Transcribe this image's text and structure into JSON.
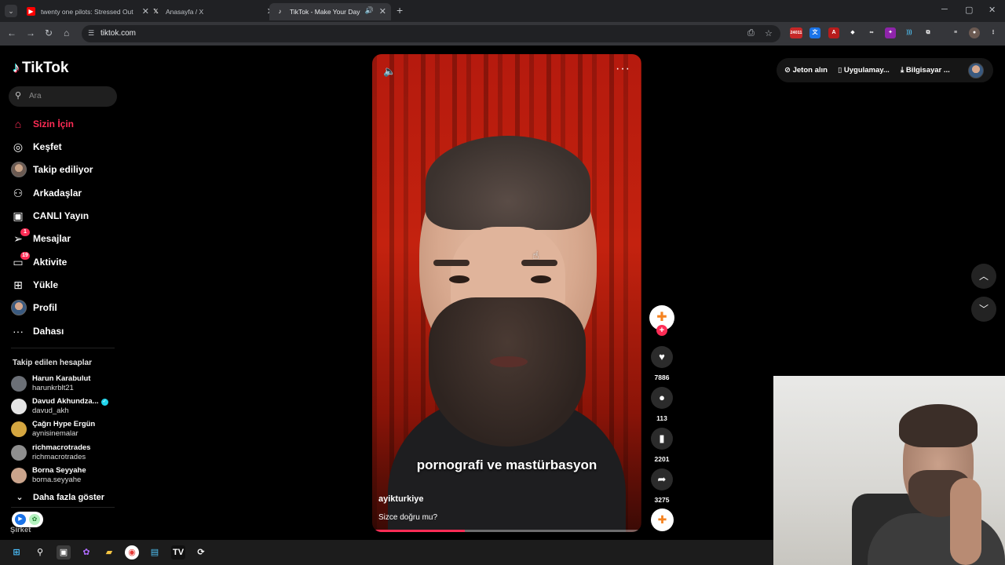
{
  "browser": {
    "tabs": [
      {
        "title": "twenty one pilots: Stressed Out",
        "favicon": "youtube-icon",
        "color": "#ff0000"
      },
      {
        "title": "Anasayfa / X",
        "favicon": "x-icon",
        "color": "#ffffff"
      },
      {
        "title": "TikTok - Make Your Day",
        "favicon": "tiktok-icon",
        "color": "#ffffff",
        "active": true,
        "playing_audio": true
      }
    ],
    "url": "tiktok.com",
    "extension_badge": "24011"
  },
  "sidebar": {
    "logo": "TikTok",
    "search_placeholder": "Ara",
    "nav": [
      {
        "label": "Sizin İçin",
        "icon": "home-icon",
        "active": true
      },
      {
        "label": "Keşfet",
        "icon": "compass-icon"
      },
      {
        "label": "Takip ediliyor",
        "icon": "following-avatar-icon"
      },
      {
        "label": "Arkadaşlar",
        "icon": "friends-icon"
      },
      {
        "label": "CANLI Yayın",
        "icon": "live-icon"
      },
      {
        "label": "Mesajlar",
        "icon": "messages-icon",
        "badge": "1"
      },
      {
        "label": "Aktivite",
        "icon": "activity-icon",
        "badge": "19"
      },
      {
        "label": "Yükle",
        "icon": "upload-icon"
      },
      {
        "label": "Profil",
        "icon": "profile-avatar-icon"
      },
      {
        "label": "Dahası",
        "icon": "more-icon"
      }
    ],
    "following_title": "Takip edilen hesaplar",
    "following": [
      {
        "name": "Harun Karabulut",
        "handle": "harunkrblt21",
        "color": "#6b6f76"
      },
      {
        "name": "Davud Akhundza...",
        "handle": "davud_akh",
        "verified": true,
        "color": "#e5e5e5"
      },
      {
        "name": "Çağrı Hype Ergün",
        "handle": "aynisinemalar",
        "color": "#d4a640"
      },
      {
        "name": "richmacrotrades",
        "handle": "richmacrotrades",
        "color": "#8e8e8e"
      },
      {
        "name": "Borna Seyyahe",
        "handle": "borna.seyyahe",
        "color": "#caa48c"
      }
    ],
    "show_more": "Daha fazla göster",
    "company": "Şirket"
  },
  "video": {
    "author": "ayikturkiye",
    "description": "Sizce doğru mu?",
    "subtitle": "pornografi ve mastürbasyon",
    "progress": 0.34
  },
  "actions": {
    "likes": "7886",
    "comments": "113",
    "saves": "2201",
    "shares": "3275"
  },
  "top_right": {
    "coins": "Jeton alın",
    "app": "Uygulamay...",
    "desktop": "Bilgisayar ..."
  },
  "colors": {
    "accent": "#fe2c55",
    "background": "#000000"
  }
}
